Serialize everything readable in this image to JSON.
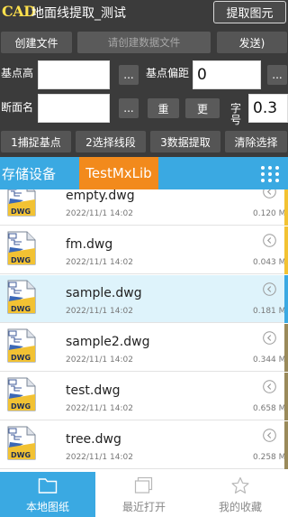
{
  "titlebar": {
    "logo": "CAD",
    "title": "地面线提取_测试",
    "extract_button": "提取图元"
  },
  "row1": {
    "create_file": "创建文件",
    "data_file_placeholder": "请创建数据文件",
    "send": "发送)"
  },
  "row2": {
    "base_elevation_label": "基点高",
    "base_elevation_value": "",
    "pick_button": "...",
    "base_offset_label": "基点偏距",
    "base_offset_value": "0",
    "pick_button2": "..."
  },
  "row3": {
    "section_name_label": "断面名",
    "section_name_value": "",
    "pick_button": "...",
    "redo_button": "重",
    "change_button": "更",
    "text_height_label": "字号",
    "text_height_value": "0.3"
  },
  "actions": {
    "capture_base": "1捕捉基点",
    "select_segment": "2选择线段",
    "extract_data": "3数据提取",
    "clear_selection": "清除选择"
  },
  "breadcrumb": {
    "storage": "存储设备",
    "current": "TestMxLib"
  },
  "files": [
    {
      "name": "empty.dwg",
      "date": "2022/11/1  14:02",
      "size": "0.120 M",
      "accent": "#f2c233",
      "selected": false
    },
    {
      "name": "fm.dwg",
      "date": "2022/11/1  14:02",
      "size": "0.043 M",
      "accent": "#f2c233",
      "selected": false
    },
    {
      "name": "sample.dwg",
      "date": "2022/11/1  14:02",
      "size": "0.181 M",
      "accent": "#3aa9e2",
      "selected": true
    },
    {
      "name": "sample2.dwg",
      "date": "2022/11/1  14:02",
      "size": "0.344 M",
      "accent": "#9a8a5a",
      "selected": false
    },
    {
      "name": "test.dwg",
      "date": "2022/11/1  14:02",
      "size": "0.658 M",
      "accent": "#9a8a5a",
      "selected": false
    },
    {
      "name": "tree.dwg",
      "date": "2022/11/1  14:02",
      "size": "0.258 M",
      "accent": "#9a8a5a",
      "selected": false
    }
  ],
  "bottom_nav": {
    "local": "本地图纸",
    "recent": "最近打开",
    "favorites": "我的收藏"
  },
  "colors": {
    "panel_bg": "#3b3b3b",
    "accent_blue": "#3aa9e2",
    "breadcrumb_orange": "#f28a1c",
    "logo_yellow": "#ffe14d",
    "selected_row": "#def3fb"
  },
  "icons": {
    "row_arrow": "chevron-left-circle-icon",
    "file": "dwg-file-icon",
    "grid": "grid-dots-icon",
    "nav_local": "folder-icon",
    "nav_recent": "recent-files-icon",
    "nav_favorites": "star-icon"
  }
}
